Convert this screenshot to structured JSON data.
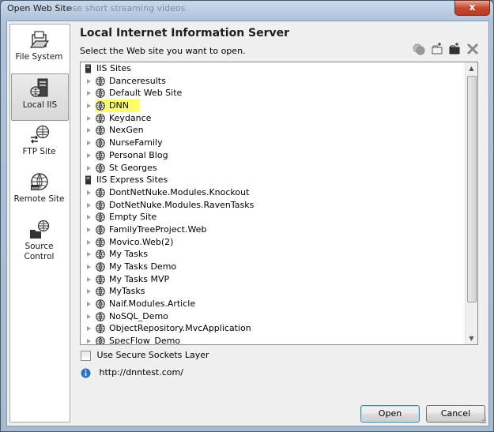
{
  "window": {
    "title": "Open Web Site",
    "title_ghost": "ose short streaming videos",
    "close_label": "x"
  },
  "sidebar": {
    "items": [
      {
        "label": "File System",
        "icon": "folder-icon",
        "selected": false
      },
      {
        "label": "Local IIS",
        "icon": "server-icon",
        "selected": true
      },
      {
        "label": "FTP Site",
        "icon": "ftp-icon",
        "selected": false
      },
      {
        "label": "Remote Site",
        "icon": "remote-globe-icon",
        "selected": false
      },
      {
        "label": "Source Control",
        "icon": "source-control-icon",
        "selected": false
      }
    ]
  },
  "main": {
    "heading": "Local Internet Information Server",
    "subheading": "Select the Web site you want to open.",
    "toolbar": [
      "create-app-icon",
      "new-folder-icon",
      "new-virtual-dir-icon",
      "delete-icon"
    ]
  },
  "tree": {
    "groups": [
      {
        "label": "IIS Sites",
        "sites": [
          "Danceresults",
          "Default Web Site",
          "DNN",
          "Keydance",
          "NexGen",
          "NurseFamily",
          "Personal Blog",
          "St Georges"
        ]
      },
      {
        "label": "IIS Express Sites",
        "sites": [
          "DontNetNuke.Modules.Knockout",
          "DotNetNuke.Modules.RavenTasks",
          "Empty Site",
          "FamilyTreeProject.Web",
          "Movico.Web(2)",
          "My Tasks",
          "My Tasks Demo",
          "My Tasks MVP",
          "MyTasks",
          "Naif.Modules.Article",
          "NoSQL_Demo",
          "ObjectRepository.MvcApplication",
          "SpecFlow_Demo"
        ]
      }
    ],
    "highlighted": "DNN"
  },
  "ssl": {
    "label": "Use Secure Sockets Layer",
    "checked": false
  },
  "url": "http://dnntest.com/",
  "buttons": {
    "open": "Open",
    "cancel": "Cancel"
  }
}
